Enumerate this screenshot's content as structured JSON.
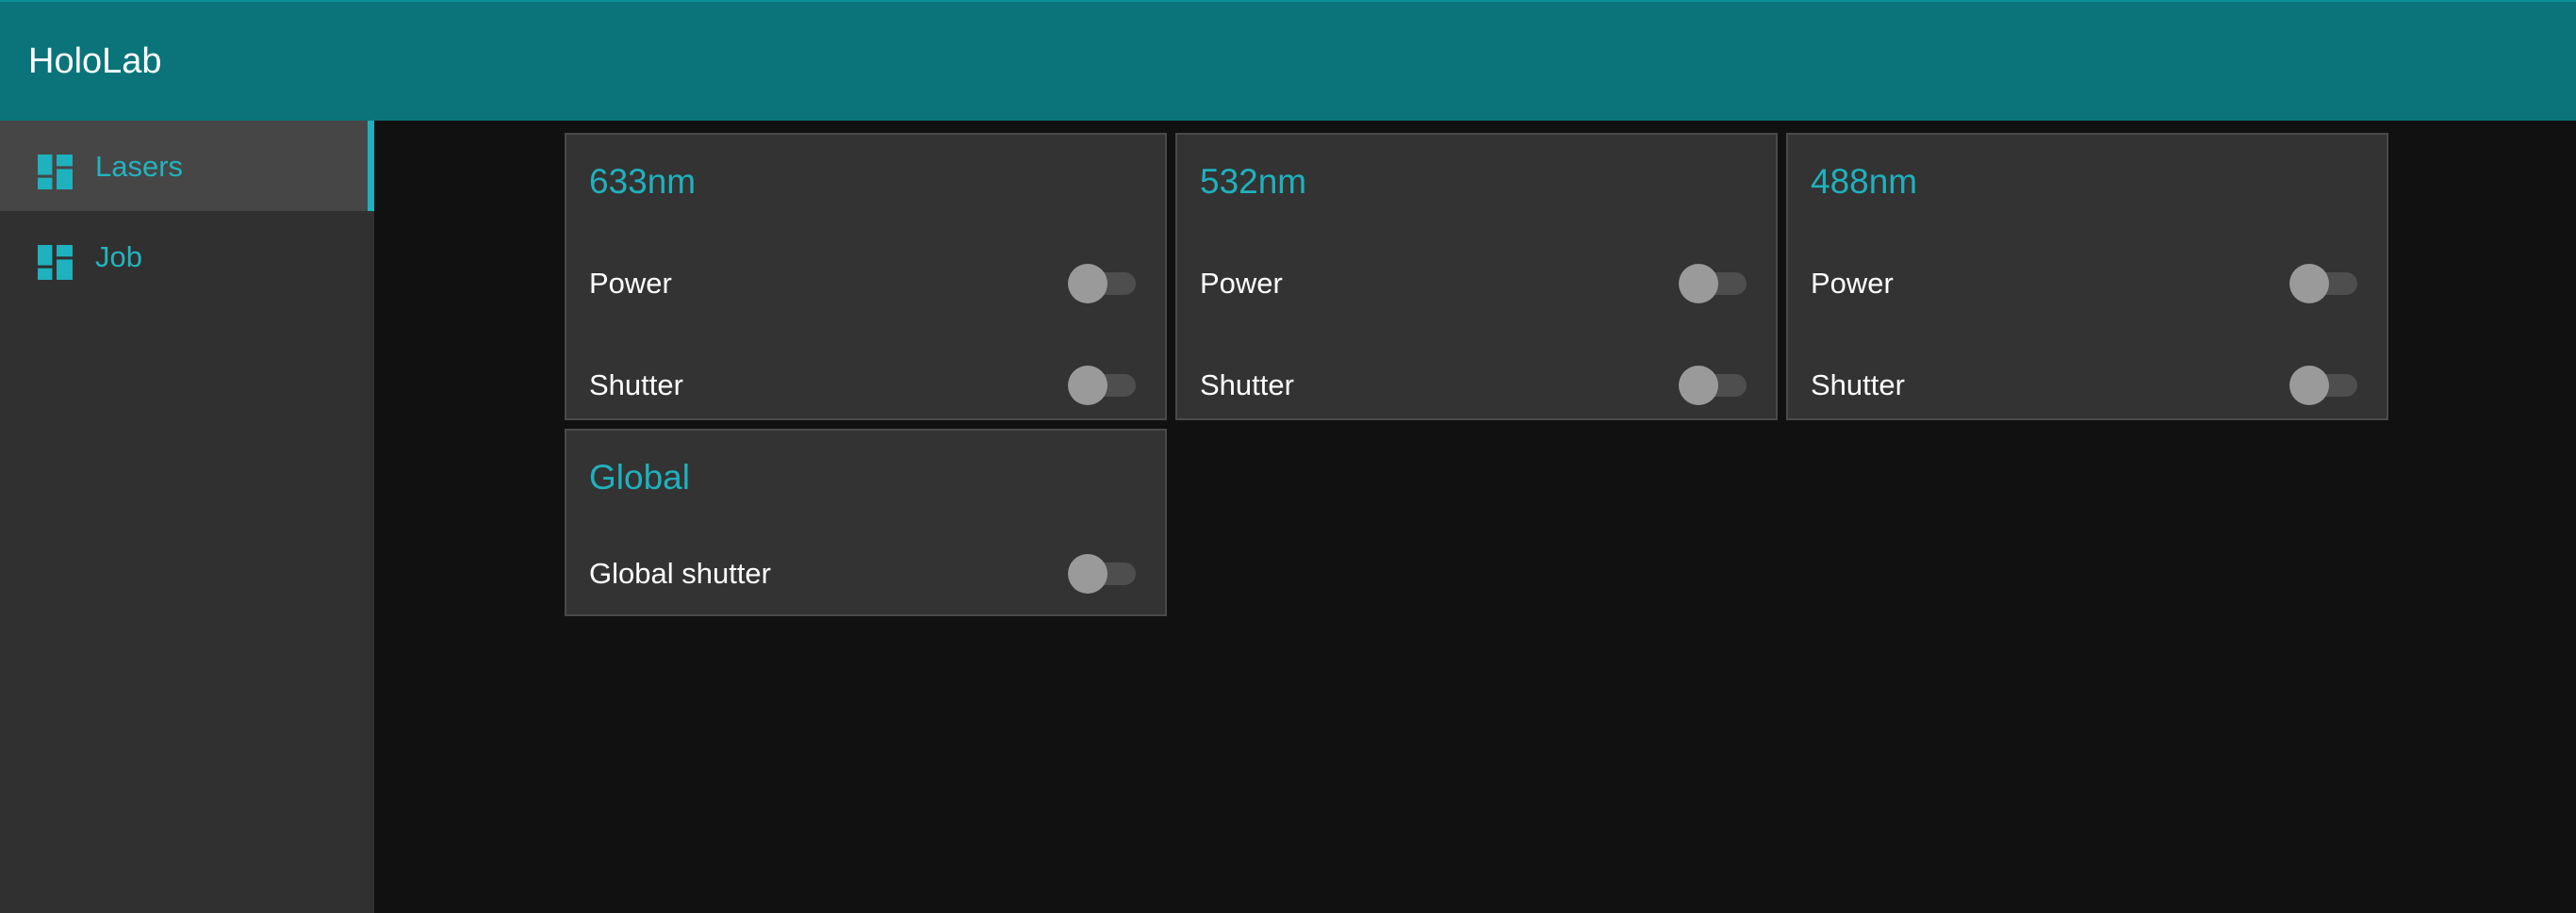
{
  "app": {
    "title": "HoloLab"
  },
  "sidebar": {
    "items": [
      {
        "label": "Lasers",
        "icon": "dashboard-icon",
        "selected": true
      },
      {
        "label": "Job",
        "icon": "dashboard-icon",
        "selected": false
      }
    ]
  },
  "cards": [
    {
      "title": "633nm",
      "rows": [
        {
          "label": "Power",
          "on": false
        },
        {
          "label": "Shutter",
          "on": false
        }
      ]
    },
    {
      "title": "532nm",
      "rows": [
        {
          "label": "Power",
          "on": false
        },
        {
          "label": "Shutter",
          "on": false
        }
      ]
    },
    {
      "title": "488nm",
      "rows": [
        {
          "label": "Power",
          "on": false
        },
        {
          "label": "Shutter",
          "on": false
        }
      ]
    },
    {
      "title": "Global",
      "rows": [
        {
          "label": "Global shutter",
          "on": false
        }
      ]
    }
  ],
  "colors": {
    "header": "#0b747b",
    "accent": "#1fb1bd",
    "sidebar": "#303030",
    "background": "#111111",
    "card": "#333333"
  }
}
